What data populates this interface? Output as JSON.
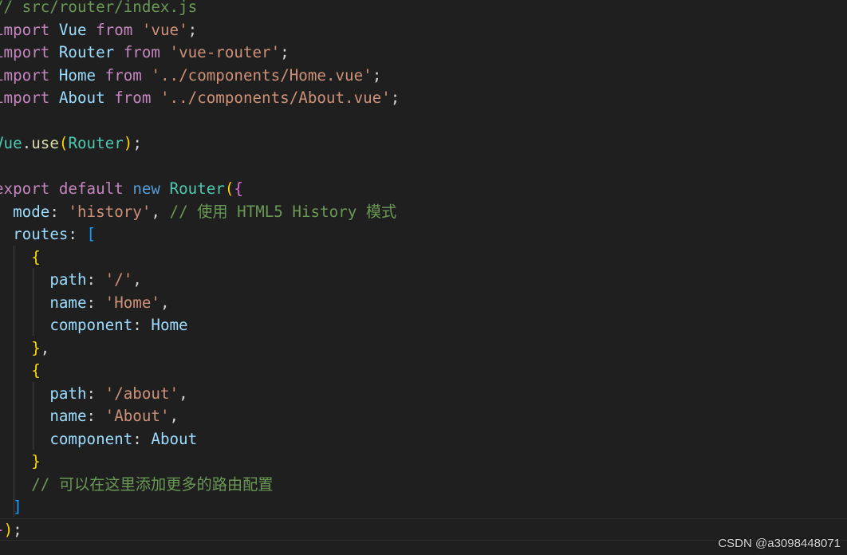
{
  "code": {
    "lines": [
      [
        {
          "t": "// src/router/index.js",
          "c": "t-comment"
        }
      ],
      [
        {
          "t": "import",
          "c": "t-kw"
        },
        {
          "t": " ",
          "c": "t-punc"
        },
        {
          "t": "Vue",
          "c": "t-var"
        },
        {
          "t": " ",
          "c": "t-punc"
        },
        {
          "t": "from",
          "c": "t-kw"
        },
        {
          "t": " ",
          "c": "t-punc"
        },
        {
          "t": "'vue'",
          "c": "t-str"
        },
        {
          "t": ";",
          "c": "t-punc"
        }
      ],
      [
        {
          "t": "import",
          "c": "t-kw"
        },
        {
          "t": " ",
          "c": "t-punc"
        },
        {
          "t": "Router",
          "c": "t-var"
        },
        {
          "t": " ",
          "c": "t-punc"
        },
        {
          "t": "from",
          "c": "t-kw"
        },
        {
          "t": " ",
          "c": "t-punc"
        },
        {
          "t": "'vue-router'",
          "c": "t-str"
        },
        {
          "t": ";",
          "c": "t-punc"
        }
      ],
      [
        {
          "t": "import",
          "c": "t-kw"
        },
        {
          "t": " ",
          "c": "t-punc"
        },
        {
          "t": "Home",
          "c": "t-var"
        },
        {
          "t": " ",
          "c": "t-punc"
        },
        {
          "t": "from",
          "c": "t-kw"
        },
        {
          "t": " ",
          "c": "t-punc"
        },
        {
          "t": "'../components/Home.vue'",
          "c": "t-str"
        },
        {
          "t": ";",
          "c": "t-punc"
        }
      ],
      [
        {
          "t": "import",
          "c": "t-kw"
        },
        {
          "t": " ",
          "c": "t-punc"
        },
        {
          "t": "About",
          "c": "t-var"
        },
        {
          "t": " ",
          "c": "t-punc"
        },
        {
          "t": "from",
          "c": "t-kw"
        },
        {
          "t": " ",
          "c": "t-punc"
        },
        {
          "t": "'../components/About.vue'",
          "c": "t-str"
        },
        {
          "t": ";",
          "c": "t-punc"
        }
      ],
      [],
      [
        {
          "t": "Vue",
          "c": "t-cls"
        },
        {
          "t": ".",
          "c": "t-punc"
        },
        {
          "t": "use",
          "c": "t-fn"
        },
        {
          "t": "(",
          "c": "t-b1"
        },
        {
          "t": "Router",
          "c": "t-cls"
        },
        {
          "t": ")",
          "c": "t-b1"
        },
        {
          "t": ";",
          "c": "t-punc"
        }
      ],
      [],
      [
        {
          "t": "export",
          "c": "t-kw"
        },
        {
          "t": " ",
          "c": "t-punc"
        },
        {
          "t": "default",
          "c": "t-kw"
        },
        {
          "t": " ",
          "c": "t-punc"
        },
        {
          "t": "new",
          "c": "t-kwb"
        },
        {
          "t": " ",
          "c": "t-punc"
        },
        {
          "t": "Router",
          "c": "t-cls"
        },
        {
          "t": "(",
          "c": "t-b1"
        },
        {
          "t": "{",
          "c": "t-b2"
        }
      ],
      [
        {
          "t": "  ",
          "c": "t-punc"
        },
        {
          "t": "mode",
          "c": "t-var"
        },
        {
          "t": ": ",
          "c": "t-punc"
        },
        {
          "t": "'history'",
          "c": "t-str"
        },
        {
          "t": ", ",
          "c": "t-punc"
        },
        {
          "t": "// 使用 HTML5 History 模式",
          "c": "t-comment"
        }
      ],
      [
        {
          "t": "  ",
          "c": "t-punc"
        },
        {
          "t": "routes",
          "c": "t-var"
        },
        {
          "t": ": ",
          "c": "t-punc"
        },
        {
          "t": "[",
          "c": "t-b3"
        }
      ],
      [
        {
          "t": "    ",
          "c": "t-punc"
        },
        {
          "t": "{",
          "c": "t-b1"
        }
      ],
      [
        {
          "t": "      ",
          "c": "t-punc"
        },
        {
          "t": "path",
          "c": "t-var"
        },
        {
          "t": ": ",
          "c": "t-punc"
        },
        {
          "t": "'/'",
          "c": "t-str"
        },
        {
          "t": ",",
          "c": "t-punc"
        }
      ],
      [
        {
          "t": "      ",
          "c": "t-punc"
        },
        {
          "t": "name",
          "c": "t-var"
        },
        {
          "t": ": ",
          "c": "t-punc"
        },
        {
          "t": "'Home'",
          "c": "t-str"
        },
        {
          "t": ",",
          "c": "t-punc"
        }
      ],
      [
        {
          "t": "      ",
          "c": "t-punc"
        },
        {
          "t": "component",
          "c": "t-var"
        },
        {
          "t": ": ",
          "c": "t-punc"
        },
        {
          "t": "Home",
          "c": "t-var"
        }
      ],
      [
        {
          "t": "    ",
          "c": "t-punc"
        },
        {
          "t": "}",
          "c": "t-b1"
        },
        {
          "t": ",",
          "c": "t-punc"
        }
      ],
      [
        {
          "t": "    ",
          "c": "t-punc"
        },
        {
          "t": "{",
          "c": "t-b1"
        }
      ],
      [
        {
          "t": "      ",
          "c": "t-punc"
        },
        {
          "t": "path",
          "c": "t-var"
        },
        {
          "t": ": ",
          "c": "t-punc"
        },
        {
          "t": "'/about'",
          "c": "t-str"
        },
        {
          "t": ",",
          "c": "t-punc"
        }
      ],
      [
        {
          "t": "      ",
          "c": "t-punc"
        },
        {
          "t": "name",
          "c": "t-var"
        },
        {
          "t": ": ",
          "c": "t-punc"
        },
        {
          "t": "'About'",
          "c": "t-str"
        },
        {
          "t": ",",
          "c": "t-punc"
        }
      ],
      [
        {
          "t": "      ",
          "c": "t-punc"
        },
        {
          "t": "component",
          "c": "t-var"
        },
        {
          "t": ": ",
          "c": "t-punc"
        },
        {
          "t": "About",
          "c": "t-var"
        }
      ],
      [
        {
          "t": "    ",
          "c": "t-punc"
        },
        {
          "t": "}",
          "c": "t-b1"
        }
      ],
      [
        {
          "t": "    ",
          "c": "t-punc"
        },
        {
          "t": "// 可以在这里添加更多的路由配置",
          "c": "t-comment"
        }
      ],
      [
        {
          "t": "  ",
          "c": "t-punc"
        },
        {
          "t": "]",
          "c": "t-b3"
        }
      ],
      [
        {
          "t": "}",
          "c": "t-b2"
        },
        {
          "t": ")",
          "c": "t-b1"
        },
        {
          "t": ";",
          "c": "t-punc"
        }
      ]
    ]
  },
  "watermark": {
    "text": "CSDN @a3098448071"
  },
  "theme": {
    "background": "#1f1f1f",
    "comment": "#6a9955",
    "keyword": "#c586c0",
    "string": "#ce9178",
    "variable": "#9cdcfe",
    "class": "#4ec9b0"
  }
}
